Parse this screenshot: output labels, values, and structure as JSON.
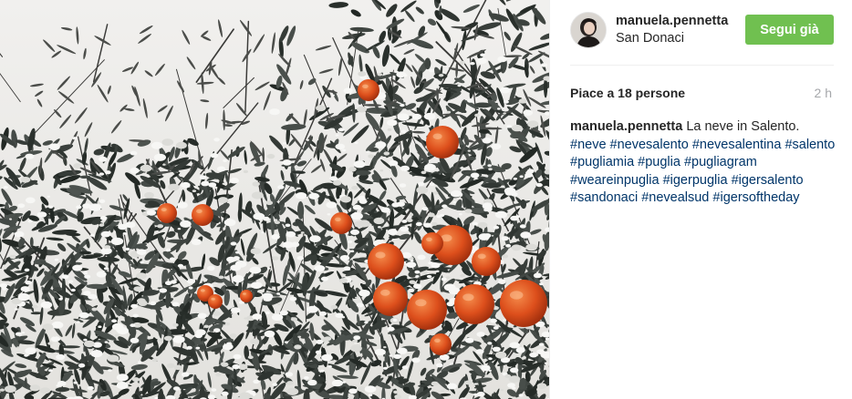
{
  "post": {
    "image_alt": "Snow-covered orange tree with ripe fruit",
    "author": {
      "username": "manuela.pennetta",
      "location": "San Donaci",
      "avatar_icon": "user-avatar"
    },
    "follow_button_label": "Segui già",
    "likes_text": "Piace a 18 persone",
    "time_ago": "2 h",
    "caption": {
      "username": "manuela.pennetta",
      "text": "La neve in Salento.",
      "hashtags": [
        "#neve",
        "#nevesalento",
        "#nevesalentina",
        "#salento",
        "#pugliamia",
        "#puglia",
        "#pugliagram",
        "#weareinpuglia",
        "#igerpuglia",
        "#igersalento",
        "#sandonaci",
        "#nevealsud",
        "#igersoftheday"
      ]
    }
  },
  "colors": {
    "follow_button": "#70c050",
    "hashtag": "#003569",
    "time": "#a5a7aa",
    "orange_fruit": "#e2541f"
  }
}
